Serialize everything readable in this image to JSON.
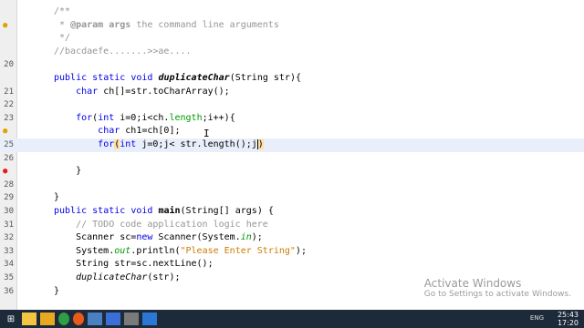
{
  "editor": {
    "lines": [
      {
        "n": "",
        "marker": "",
        "code": "/**"
      },
      {
        "n": "",
        "marker": "bulb",
        "code": " * @param args the command line arguments"
      },
      {
        "n": "",
        "marker": "",
        "code": " */"
      },
      {
        "n": "",
        "marker": "",
        "code": "//bacdaefe.......>>ae...."
      },
      {
        "n": "20",
        "marker": "",
        "code": ""
      },
      {
        "n": "",
        "marker": "",
        "code": "public static void duplicateChar(String str){"
      },
      {
        "n": "21",
        "marker": "",
        "code": "    char ch[]=str.toCharArray();"
      },
      {
        "n": "22",
        "marker": "",
        "code": ""
      },
      {
        "n": "23",
        "marker": "",
        "code": "    for(int i=0;i<ch.length;i++){"
      },
      {
        "n": "",
        "marker": "bulb",
        "code": "        char ch1=ch[0];"
      },
      {
        "n": "25",
        "marker": "",
        "code": "        for(int j=0;j< str.length();j)"
      },
      {
        "n": "26",
        "marker": "",
        "code": ""
      },
      {
        "n": "",
        "marker": "error",
        "code": "    }"
      },
      {
        "n": "28",
        "marker": "",
        "code": ""
      },
      {
        "n": "29",
        "marker": "",
        "code": "}"
      },
      {
        "n": "30",
        "marker": "",
        "code": "public static void main(String[] args) {"
      },
      {
        "n": "31",
        "marker": "",
        "code": "    // TODO code application logic here"
      },
      {
        "n": "32",
        "marker": "",
        "code": "    Scanner sc=new Scanner(System.in);"
      },
      {
        "n": "33",
        "marker": "",
        "code": "    System.out.println(\"Please Enter String\");"
      },
      {
        "n": "34",
        "marker": "",
        "code": "    String str=sc.nextLine();"
      },
      {
        "n": "35",
        "marker": "",
        "code": "    duplicateChar(str);"
      },
      {
        "n": "36",
        "marker": "",
        "code": "}"
      }
    ],
    "current_line_index": 10
  },
  "watermark": {
    "title": "Activate Windows",
    "subtitle": "Go to Settings to activate Windows."
  },
  "taskbar": {
    "icons": [
      "start-icon",
      "file-explorer-icon",
      "folder-icon",
      "chrome-icon",
      "firefox-icon",
      "netbeans-icon",
      "mail-icon",
      "media-icon",
      "store-icon"
    ],
    "time": "17:20",
    "tray_text": "ENG"
  },
  "top_right_time": "25:43",
  "colors": {
    "keyword": "#0000e6",
    "comment": "#969696",
    "string": "#ce7b00",
    "current_line": "#e9effa",
    "taskbar": "#1d2a3a"
  }
}
